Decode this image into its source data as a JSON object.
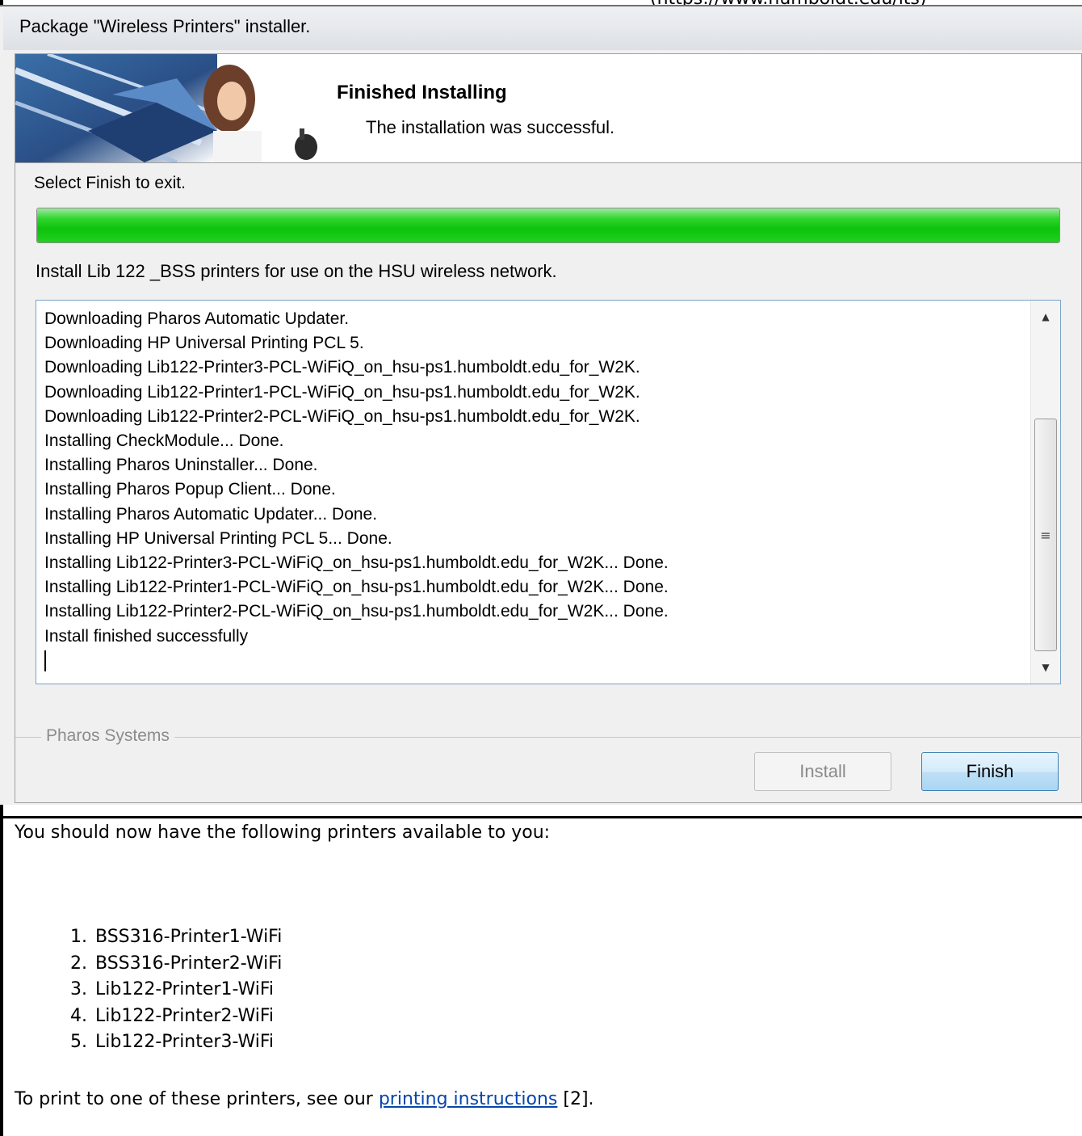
{
  "window": {
    "title": "Package \"Wireless Printers\" installer.",
    "banner_title": "Finished Installing",
    "banner_subtitle": "The installation was successful.",
    "instruction": "Select Finish to exit.",
    "progress_percent": 100,
    "description": "Install Lib 122 _BSS printers for use on the HSU wireless network.",
    "log_lines": [
      "Downloading Pharos Automatic Updater.",
      "Downloading HP Universal Printing PCL 5.",
      "Downloading Lib122-Printer3-PCL-WiFiQ_on_hsu-ps1.humboldt.edu_for_W2K.",
      "Downloading Lib122-Printer1-PCL-WiFiQ_on_hsu-ps1.humboldt.edu_for_W2K.",
      "Downloading Lib122-Printer2-PCL-WiFiQ_on_hsu-ps1.humboldt.edu_for_W2K.",
      "Installing CheckModule... Done.",
      "Installing Pharos Uninstaller... Done.",
      "Installing Pharos Popup Client... Done.",
      "Installing Pharos Automatic Updater... Done.",
      "Installing HP Universal Printing PCL 5... Done.",
      "Installing Lib122-Printer3-PCL-WiFiQ_on_hsu-ps1.humboldt.edu_for_W2K... Done.",
      "Installing Lib122-Printer1-PCL-WiFiQ_on_hsu-ps1.humboldt.edu_for_W2K... Done.",
      "Installing Lib122-Printer2-PCL-WiFiQ_on_hsu-ps1.humboldt.edu_for_W2K... Done.",
      "Install finished successfully"
    ],
    "group_label": "Pharos Systems",
    "install_button": "Install",
    "finish_button": "Finish"
  },
  "page": {
    "top_partial": "(https://www.humboldt.edu/its)",
    "intro": "You should now have the following printers available to you:",
    "printers": [
      {
        "num": "1.",
        "name": "BSS316-Printer1-WiFi"
      },
      {
        "num": "2.",
        "name": "BSS316-Printer2-WiFi"
      },
      {
        "num": "3.",
        "name": "Lib122-Printer1-WiFi"
      },
      {
        "num": "4.",
        "name": "Lib122-Printer2-WiFi"
      },
      {
        "num": "5.",
        "name": "Lib122-Printer3-WiFi"
      }
    ],
    "print_text_before": "To print to one of these printers, see our ",
    "print_link": "printing instructions",
    "print_text_after": " [2]."
  },
  "colors": {
    "progress_green": "#0dc20d",
    "link": "#0645ad",
    "finish_button_border": "#3c7fb1"
  }
}
